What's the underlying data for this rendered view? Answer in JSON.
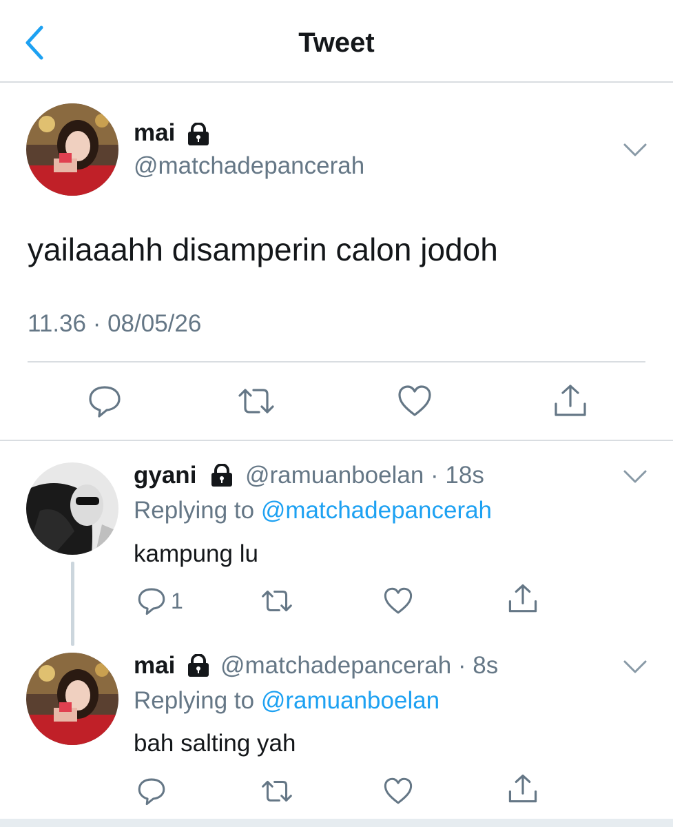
{
  "header": {
    "title": "Tweet"
  },
  "main_tweet": {
    "name": "mai",
    "handle": "@matchadepancerah",
    "text": "yailaaahh disamperin calon jodoh",
    "timestamp": "11.36 · 08/05/26"
  },
  "replies": [
    {
      "name": "gyani",
      "handle": "@ramuanboelan",
      "time": "· 18s",
      "replying_label": "Replying to",
      "replying_handle": "@matchadepancerah",
      "text": "kampung lu",
      "reply_count": "1"
    },
    {
      "name": "mai",
      "handle": "@matchadepancerah",
      "time": "· 8s",
      "replying_label": "Replying to",
      "replying_handle": "@ramuanboelan",
      "text": "bah salting yah"
    }
  ],
  "icons": {
    "back": "chevron-left-icon",
    "lock": "lock-icon",
    "more": "chevron-down-icon",
    "reply": "reply-icon",
    "retweet": "retweet-icon",
    "like": "heart-icon",
    "share": "share-icon"
  },
  "colors": {
    "accent": "#1da1f2",
    "secondary_text": "#657786",
    "divider": "#d9dde1"
  }
}
